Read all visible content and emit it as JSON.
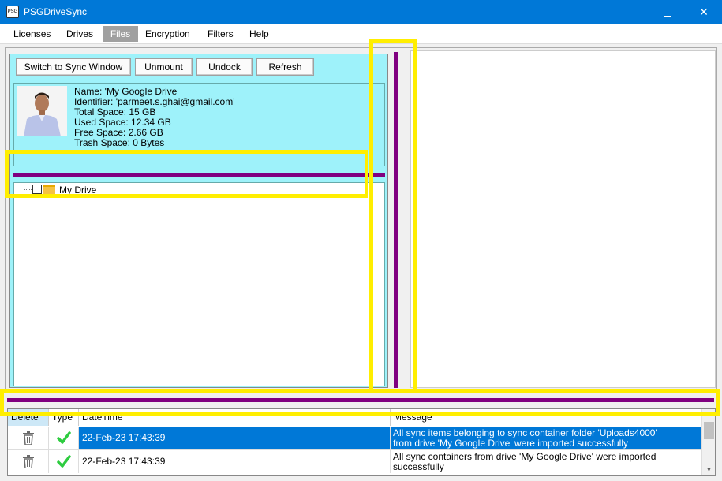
{
  "window": {
    "title": "PSGDriveSync",
    "icon_label": "PSG"
  },
  "menu": {
    "items": [
      {
        "label": "Licenses",
        "active": false
      },
      {
        "label": "Drives",
        "active": false
      },
      {
        "label": "Files",
        "active": true
      },
      {
        "label": "Encryption",
        "active": false
      },
      {
        "label": "Filters",
        "active": false
      },
      {
        "label": "Help",
        "active": false
      }
    ]
  },
  "toolbar": {
    "switch_label": "Switch to Sync Window",
    "unmount_label": "Unmount",
    "undock_label": "Undock",
    "refresh_label": "Refresh"
  },
  "drive_info": {
    "name": "Name: 'My Google Drive'",
    "identifier": "Identifier: 'parmeet.s.ghai@gmail.com'",
    "total_space": "Total Space: 15 GB",
    "used_space": "Used Space: 12.34 GB",
    "free_space": "Free Space: 2.66 GB",
    "trash_space": "Trash Space: 0 Bytes"
  },
  "tree": {
    "root_label": "My Drive"
  },
  "log_table": {
    "headers": {
      "delete": "Delete",
      "type": "Type",
      "datetime": "DateTime",
      "message": "Message"
    },
    "rows": [
      {
        "datetime": "22-Feb-23 17:43:39",
        "message_line1": "All sync items belonging to sync container folder 'Uploads4000'",
        "message_line2": "from drive 'My Google Drive' were imported successfully",
        "selected": true
      },
      {
        "datetime": "22-Feb-23 17:43:39",
        "message_line1": "All sync containers from drive 'My Google Drive' were imported",
        "message_line2": "successfully",
        "selected": false
      }
    ]
  },
  "colors": {
    "titlebar": "#0078d7",
    "panel_cyan": "#9ef2fa",
    "splitter_purple": "#800080",
    "highlight_yellow": "#ffee00",
    "success_green": "#2ecc40"
  }
}
